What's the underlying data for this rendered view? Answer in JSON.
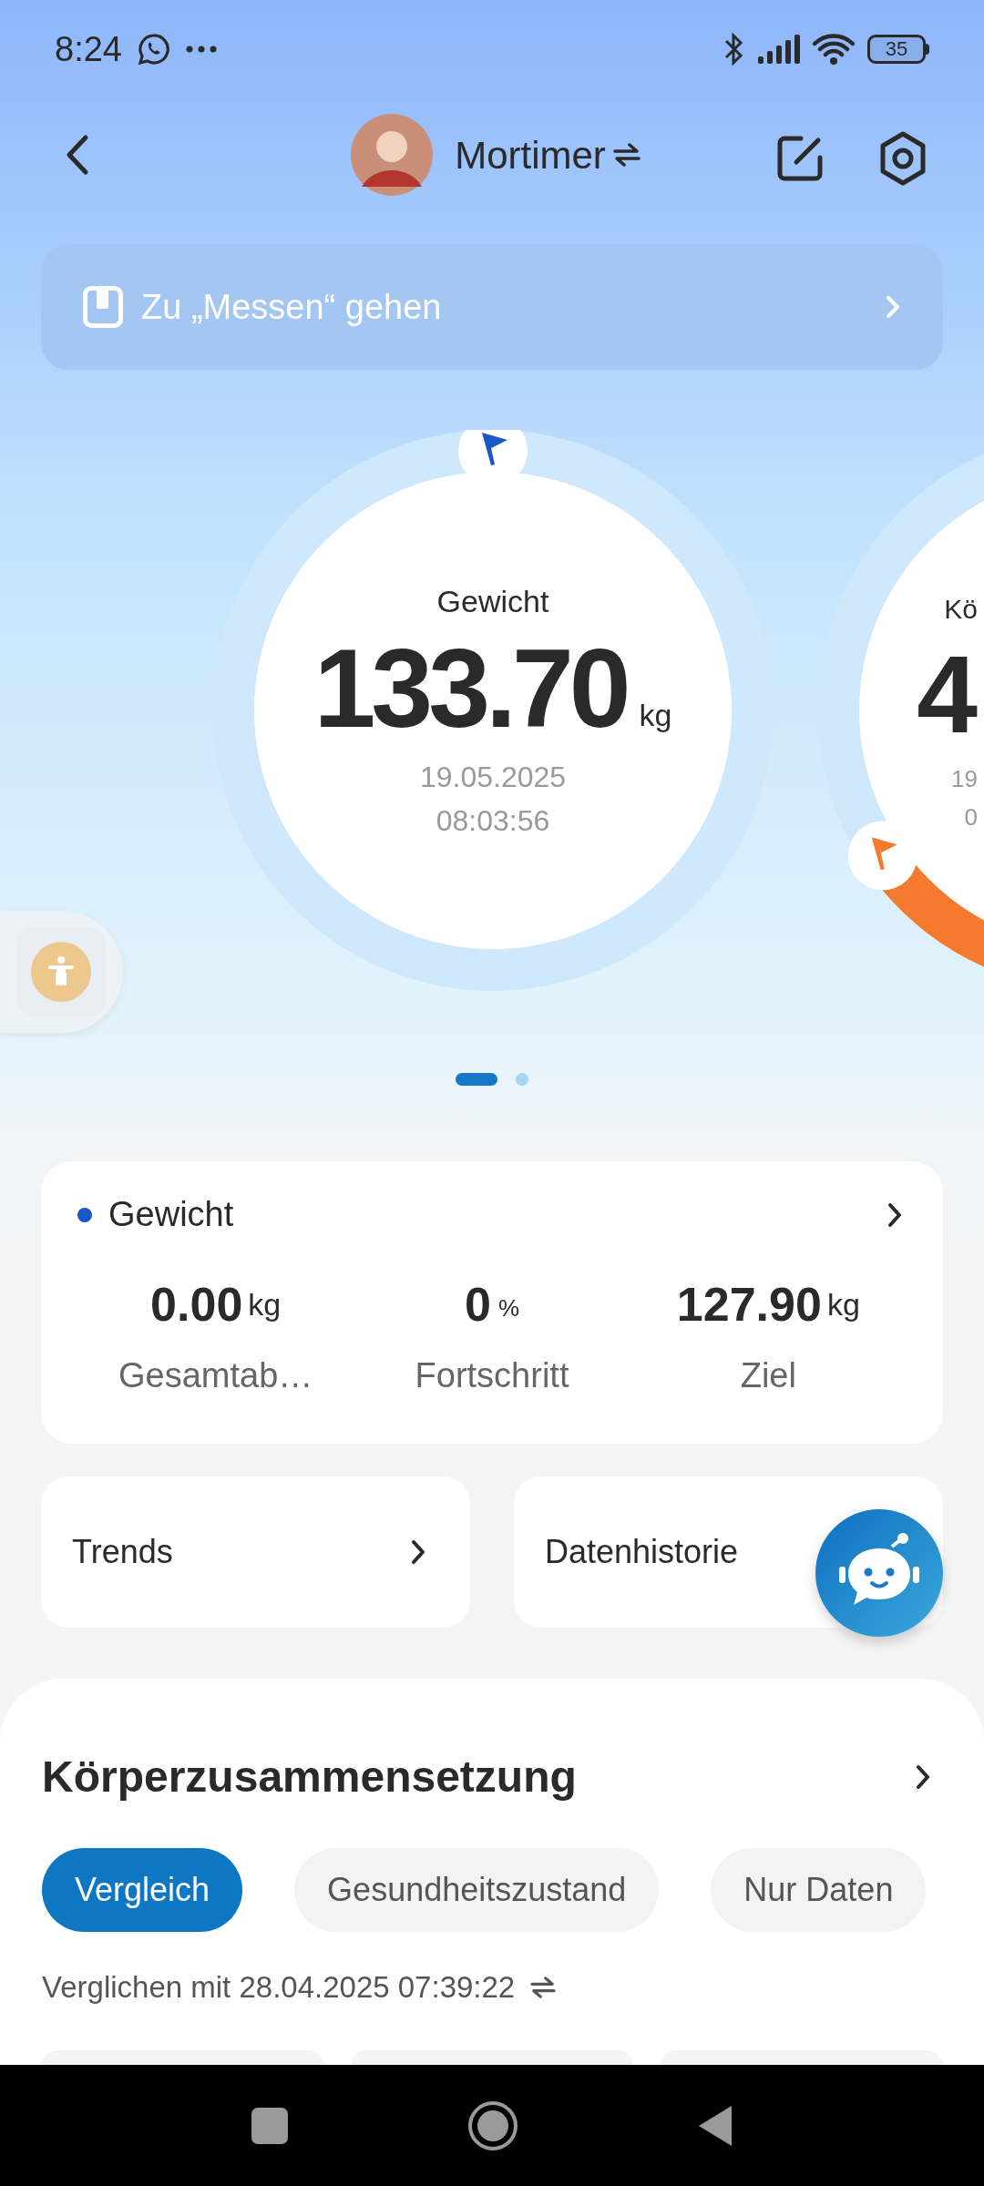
{
  "status_bar": {
    "time": "8:24",
    "battery": "35"
  },
  "header": {
    "user_name": "Mortimer"
  },
  "measure_banner": {
    "label": "Zu „Messen“ gehen"
  },
  "gauges": [
    {
      "kind": "full",
      "title": "Gewicht",
      "value": "133.70",
      "unit": "kg",
      "date": "19.05.2025",
      "time": "08:03:56",
      "color": "#1a56c4"
    },
    {
      "kind": "peek",
      "title": "Kö",
      "value": "4",
      "date": "19",
      "time": "0",
      "color": "#f57a2e"
    }
  ],
  "pager": [
    {
      "selected": true
    },
    {
      "selected": false
    }
  ],
  "weight_card": {
    "title": "Gewicht",
    "stats": [
      {
        "value": "0.00",
        "unit": "kg",
        "label": "Gesamtab…"
      },
      {
        "value": "0",
        "unit": "%",
        "label": "Fortschritt"
      },
      {
        "value": "127.90",
        "unit": "kg",
        "label": "Ziel"
      }
    ]
  },
  "links": [
    {
      "label": "Trends"
    },
    {
      "label": "Datenhistorie"
    }
  ],
  "body_composition": {
    "title": "Körperzusammensetzung",
    "tabs": [
      {
        "label": "Vergleich",
        "selected": true
      },
      {
        "label": "Gesundheitszustand",
        "selected": false
      },
      {
        "label": "Nur Daten",
        "selected": false
      }
    ],
    "compared_with": "Verglichen mit 28.04.2025 07:39:22"
  }
}
